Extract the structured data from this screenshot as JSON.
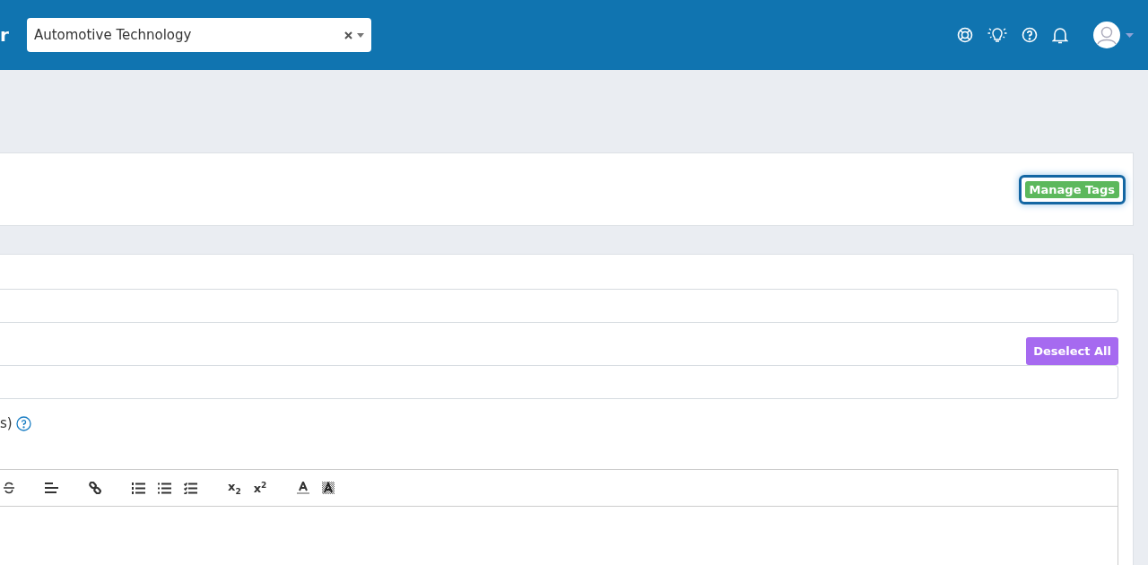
{
  "header": {
    "brand_fragment": "r",
    "program_select": {
      "value": "Automotive Technology"
    }
  },
  "tags_card": {
    "manage_button": "Manage Tags"
  },
  "form": {
    "deselect_button": "Deselect All",
    "label_fragment": "s)",
    "toolbar": [
      {
        "kind": "strike"
      },
      {
        "kind": "align"
      },
      {
        "kind": "link"
      },
      {
        "kind": "ordered"
      },
      {
        "kind": "bullets"
      },
      {
        "kind": "checklist"
      },
      {
        "kind": "subscript",
        "label": "x",
        "index": "2"
      },
      {
        "kind": "superscript",
        "label": "x",
        "index": "2"
      },
      {
        "kind": "font-color"
      },
      {
        "kind": "highlight"
      }
    ]
  }
}
